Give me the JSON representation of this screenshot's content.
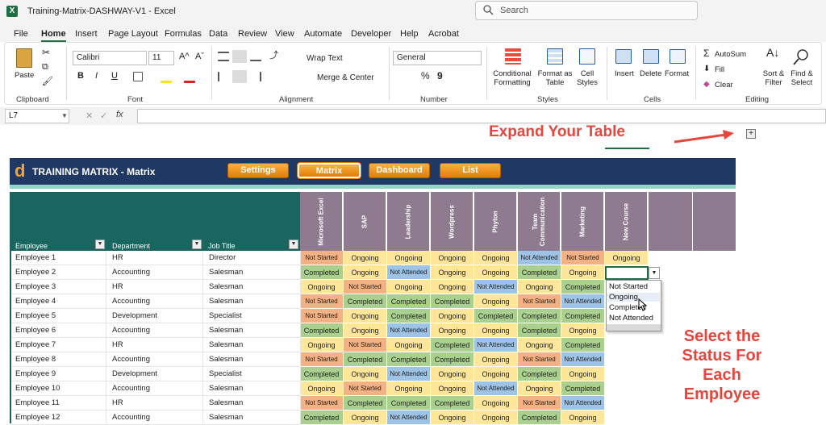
{
  "window": {
    "title": "Training-Matrix-DASHWAY-V1  -  Excel",
    "search_placeholder": "Search"
  },
  "tabs": [
    "File",
    "Home",
    "Insert",
    "Page Layout",
    "Formulas",
    "Data",
    "Review",
    "View",
    "Automate",
    "Developer",
    "Help",
    "Acrobat"
  ],
  "ribbon": {
    "clipboard": {
      "paste": "Paste",
      "group": "Clipboard"
    },
    "font": {
      "name": "Calibri",
      "size": "11",
      "group": "Font",
      "grow": "A^",
      "shrink": "Aˇ",
      "bold": "B",
      "italic": "I",
      "underline": "U"
    },
    "alignment": {
      "wrap": "Wrap Text",
      "merge": "Merge & Center",
      "group": "Alignment"
    },
    "number": {
      "format": "General",
      "group": "Number",
      "percent": "%",
      "comma": "9"
    },
    "styles": {
      "conditional": "Conditional Formatting",
      "format_table": "Format as Table",
      "cell_styles": "Cell Styles",
      "group": "Styles"
    },
    "cells": {
      "insert": "Insert",
      "delete": "Delete",
      "format": "Format",
      "group": "Cells"
    },
    "editing": {
      "autosum": "AutoSum",
      "fill": "Fill",
      "clear": "Clear",
      "sort": "Sort & Filter",
      "find": "Find & Select",
      "group": "Editing"
    }
  },
  "formula_bar": {
    "cell_ref": "L7",
    "fx": "fx",
    "value": ""
  },
  "annotations": {
    "expand": "Expand Your Table",
    "select": "Select the Status For Each Employee"
  },
  "dashboard": {
    "title": "TRAINING MATRIX - Matrix",
    "nav": [
      "Settings",
      "Matrix",
      "Dashboard",
      "List"
    ]
  },
  "headers": {
    "employee": "Employee",
    "department": "Department",
    "job_title": "Job Title"
  },
  "courses": [
    "Microsoft Excel",
    "SAP",
    "Leadership",
    "Wordpress",
    "Phyton",
    "Team Communication",
    "Marketing",
    "New Course"
  ],
  "status_colors": {
    "Not Started": "#f4b183",
    "Ongoing": "#ffe699",
    "Completed": "#a9d08e",
    "Not Attended": "#9dc3e6"
  },
  "rows": [
    {
      "employee": "Employee 1",
      "department": "HR",
      "job": "Director",
      "status": [
        "Not Started",
        "Ongoing",
        "Ongoing",
        "Ongoing",
        "Ongoing",
        "Not Attended",
        "Not Started",
        "Ongoing"
      ]
    },
    {
      "employee": "Employee 2",
      "department": "Accounting",
      "job": "Salesman",
      "status": [
        "Completed",
        "Ongoing",
        "Not Attended",
        "Ongoing",
        "Ongoing",
        "Completed",
        "Ongoing",
        ""
      ]
    },
    {
      "employee": "Employee 3",
      "department": "HR",
      "job": "Salesman",
      "status": [
        "Ongoing",
        "Not Started",
        "Ongoing",
        "Ongoing",
        "Not Attended",
        "Ongoing",
        "Completed",
        ""
      ]
    },
    {
      "employee": "Employee 4",
      "department": "Accounting",
      "job": "Salesman",
      "status": [
        "Not Started",
        "Completed",
        "Completed",
        "Completed",
        "Ongoing",
        "Not Started",
        "Not Attended",
        ""
      ]
    },
    {
      "employee": "Employee 5",
      "department": "Development",
      "job": "Specialist",
      "status": [
        "Not Started",
        "Ongoing",
        "Completed",
        "Ongoing",
        "Completed",
        "Completed",
        "Completed",
        ""
      ]
    },
    {
      "employee": "Employee 6",
      "department": "Accounting",
      "job": "Salesman",
      "status": [
        "Completed",
        "Ongoing",
        "Not Attended",
        "Ongoing",
        "Ongoing",
        "Completed",
        "Ongoing",
        ""
      ]
    },
    {
      "employee": "Employee 7",
      "department": "HR",
      "job": "Salesman",
      "status": [
        "Ongoing",
        "Not Started",
        "Ongoing",
        "Completed",
        "Not Attended",
        "Ongoing",
        "Completed",
        ""
      ]
    },
    {
      "employee": "Employee 8",
      "department": "Accounting",
      "job": "Salesman",
      "status": [
        "Not Started",
        "Completed",
        "Completed",
        "Completed",
        "Ongoing",
        "Not Started",
        "Not Attended",
        ""
      ]
    },
    {
      "employee": "Employee 9",
      "department": "Development",
      "job": "Specialist",
      "status": [
        "Completed",
        "Ongoing",
        "Not Attended",
        "Ongoing",
        "Ongoing",
        "Completed",
        "Ongoing",
        ""
      ]
    },
    {
      "employee": "Employee 10",
      "department": "Accounting",
      "job": "Salesman",
      "status": [
        "Ongoing",
        "Not Started",
        "Ongoing",
        "Ongoing",
        "Not Attended",
        "Ongoing",
        "Completed",
        ""
      ]
    },
    {
      "employee": "Employee 11",
      "department": "HR",
      "job": "Salesman",
      "status": [
        "Not Started",
        "Completed",
        "Completed",
        "Completed",
        "Ongoing",
        "Not Started",
        "Not Attended",
        ""
      ]
    },
    {
      "employee": "Employee 12",
      "department": "Accounting",
      "job": "Salesman",
      "status": [
        "Completed",
        "Ongoing",
        "Not Attended",
        "Ongoing",
        "Ongoing",
        "Completed",
        "Ongoing",
        ""
      ]
    }
  ],
  "dropdown_options": [
    "Not Started",
    "Ongoing",
    "Completed",
    "Not Attended"
  ]
}
